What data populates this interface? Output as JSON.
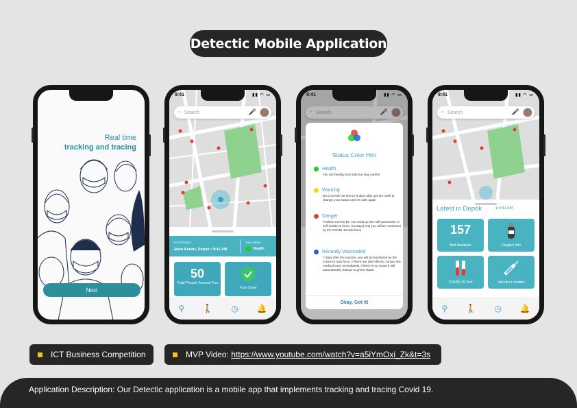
{
  "title": "Detectic Mobile Application",
  "status_time": "9:41",
  "intro": {
    "tagline_line1": "Real time",
    "tagline_line2": "tracking and tracing",
    "next_label": "Next"
  },
  "search": {
    "placeholder": "Search"
  },
  "home": {
    "location_label": "Your location",
    "location_value": "Jalan Kenari, Depok • 9:41 AM",
    "status_label": "Your status",
    "status_value": "Health",
    "people_count": "50",
    "people_label": "Total People Around You",
    "zone_label": "Your Zone"
  },
  "hint": {
    "title": "Status Color Hint",
    "items": [
      {
        "name": "Health",
        "color": "#1fd11f",
        "text": "You are healthy and safe but stay careful"
      },
      {
        "name": "Warning",
        "color": "#f1dc12",
        "text": "Do a COVID-19 Test (2-3 days after get the notif) to change your status until it's safe again"
      },
      {
        "name": "Danger",
        "color": "#e53935",
        "text": "Positive COVID-19. You must go into self-quarantine or self-isolate at home (14 days) and you will be monitored by the COVID-19 task force"
      },
      {
        "name": "Recently Vaccinated",
        "color": "#1e63d6",
        "text": "7 days after the vaccine, you will be monitored by the Covid-19 task force. If there are side effects, contact the medical team immediately. If there is no report it will automatically change to green status"
      }
    ],
    "ok_label": "Okay, Got It!"
  },
  "latest": {
    "title": "Latest in Depok",
    "time": "9:41 AM",
    "tiles": [
      {
        "value": "157",
        "label": "Bed Available"
      },
      {
        "value": "",
        "label": "Oxygen Info"
      },
      {
        "value": "",
        "label": "COVID-19 Test"
      },
      {
        "value": "",
        "label": "Vaccine Location"
      }
    ]
  },
  "badges": {
    "competition": "ICT Business Competition",
    "video_prefix": "MVP Video: ",
    "video_url": "https://www.youtube.com/watch?v=a5iYmOxi_Zk&t=3s"
  },
  "description": "Application Description: Our Detectic application is a mobile app that implements tracking and tracing Covid 19.",
  "colors": {
    "accent": "#3fa9bb",
    "dark": "#262626",
    "bullet": "#f5c518"
  }
}
